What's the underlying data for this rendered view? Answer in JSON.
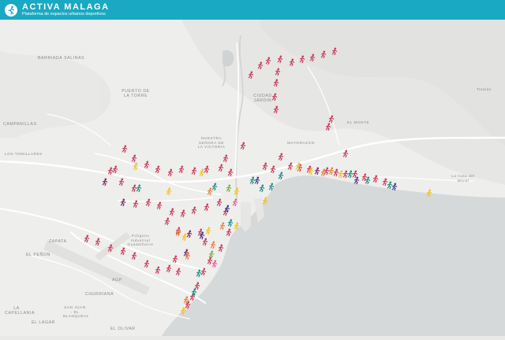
{
  "header": {
    "brand": "ACTIVA MALAGA",
    "tagline": "Plataforma de espacios urbanos deportivos",
    "logo_icon": "runner-logo-icon",
    "background_color": "#1aa9c2"
  },
  "map": {
    "land_color": "#eeeeec",
    "sea_color": "#d6d9da",
    "labels": {
      "barriada_salinas": "BARRIADA SALINAS",
      "puerto_de_la_torre": "PUERTO DE LA TORRE",
      "ciudad_jardin": "CIUDAD JARDIN",
      "campanillas": "CAMPANILLAS",
      "nuestra_senora": "NUESTRA SEÑORA DE LA VICTORIA",
      "los_tomillares": "LOS TOMILLARES",
      "el_penon": "EL PEÑON",
      "zapata": "ZAPATA",
      "la_capellania": "LA CAPELLANIA",
      "el_lagar": "EL LAGAR",
      "churriana": "CHURRIANA",
      "san_juan": "SAN JUAN - EL BLANQUEAL",
      "el_olivar": "EL OLIVAR",
      "poligono": "Poligono Industrial Guadalhorce",
      "la_cala": "La Cala del Moral",
      "totalan": "Totalán",
      "agp": "AGP",
      "la_mosca": "MAYORAZGO",
      "monte": "EL MONTE"
    },
    "marker_colors": {
      "running": "#c93c5c",
      "fitness": "#7a2a6b",
      "yellow": "#f0c22a",
      "teal": "#1f8f88",
      "orange": "#e8823a",
      "green": "#7bb03a",
      "purple": "#4b3a8e",
      "pink": "#e85a9a"
    }
  }
}
